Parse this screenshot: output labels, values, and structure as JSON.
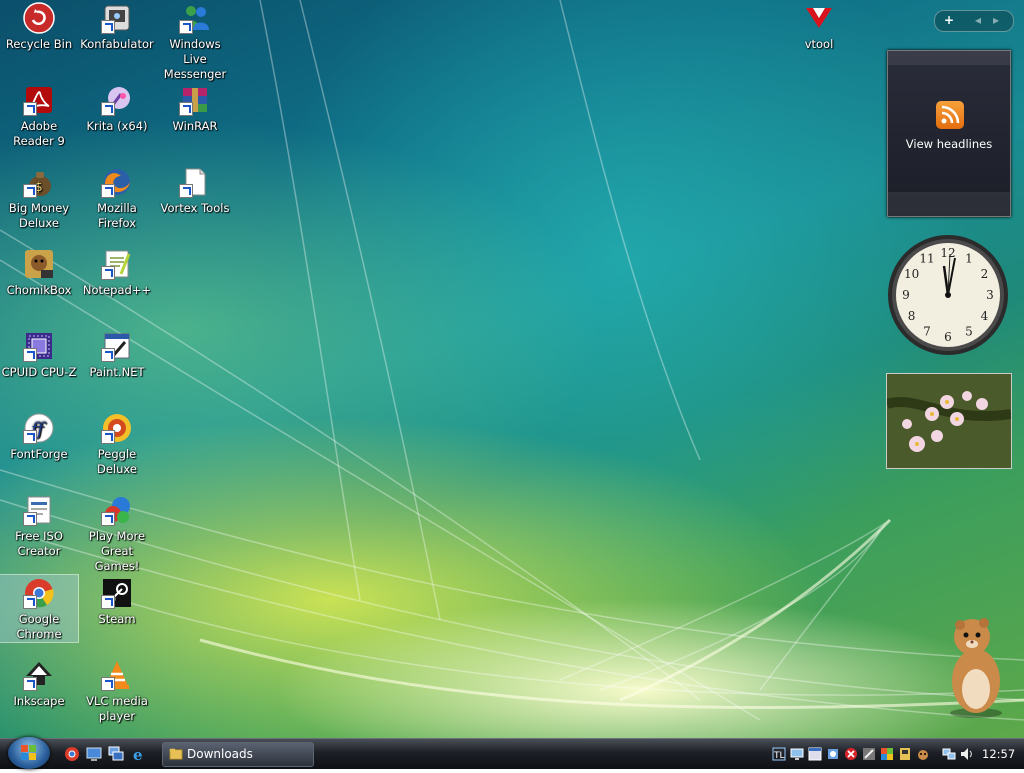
{
  "desktop": {
    "icons": [
      {
        "label": "Recycle Bin",
        "icon": "recycle-bin-icon"
      },
      {
        "label": "Konfabulator",
        "icon": "konfabulator-icon"
      },
      {
        "label": "Windows Live Messenger",
        "icon": "messenger-icon"
      },
      {
        "label": "Adobe Reader 9",
        "icon": "adobe-reader-icon"
      },
      {
        "label": "Krita (x64)",
        "icon": "krita-icon"
      },
      {
        "label": "WinRAR",
        "icon": "winrar-icon"
      },
      {
        "label": "Big Money Deluxe",
        "icon": "big-money-icon"
      },
      {
        "label": "Mozilla Firefox",
        "icon": "firefox-icon"
      },
      {
        "label": "Vortex Tools",
        "icon": "vortex-tools-icon"
      },
      {
        "label": "ChomikBox",
        "icon": "chomikbox-icon"
      },
      {
        "label": "Notepad++",
        "icon": "notepadpp-icon"
      },
      {
        "label": "CPUID CPU-Z",
        "icon": "cpuz-icon"
      },
      {
        "label": "Paint.NET",
        "icon": "paintnet-icon"
      },
      {
        "label": "FontForge",
        "icon": "fontforge-icon"
      },
      {
        "label": "Peggle Deluxe",
        "icon": "peggle-icon"
      },
      {
        "label": "Free ISO Creator",
        "icon": "free-iso-icon"
      },
      {
        "label": "Play More Great Games!",
        "icon": "play-more-games-icon"
      },
      {
        "label": "Google Chrome",
        "icon": "chrome-icon"
      },
      {
        "label": "Steam",
        "icon": "steam-icon"
      },
      {
        "label": "Inkscape",
        "icon": "inkscape-icon"
      },
      {
        "label": "VLC media player",
        "icon": "vlc-icon"
      },
      {
        "label": "vtool",
        "icon": "vtool-icon"
      }
    ]
  },
  "sidebar": {
    "add_label": "+",
    "prev_label": "◂",
    "next_label": "▸",
    "feed_label": "View headlines",
    "clock_numbers": [
      "12",
      "1",
      "2",
      "3",
      "4",
      "5",
      "6",
      "7",
      "8",
      "9",
      "10",
      "11"
    ]
  },
  "taskbar": {
    "task_label": "Downloads",
    "clock": "12:57",
    "quick_launch": [
      "chrome-icon",
      "show-desktop-icon",
      "switch-windows-icon",
      "internet-explorer-icon"
    ]
  },
  "colors": {
    "taskbar": "#1d2026",
    "selection": "#b4d2eb",
    "feed_icon": "#f28c1e"
  }
}
